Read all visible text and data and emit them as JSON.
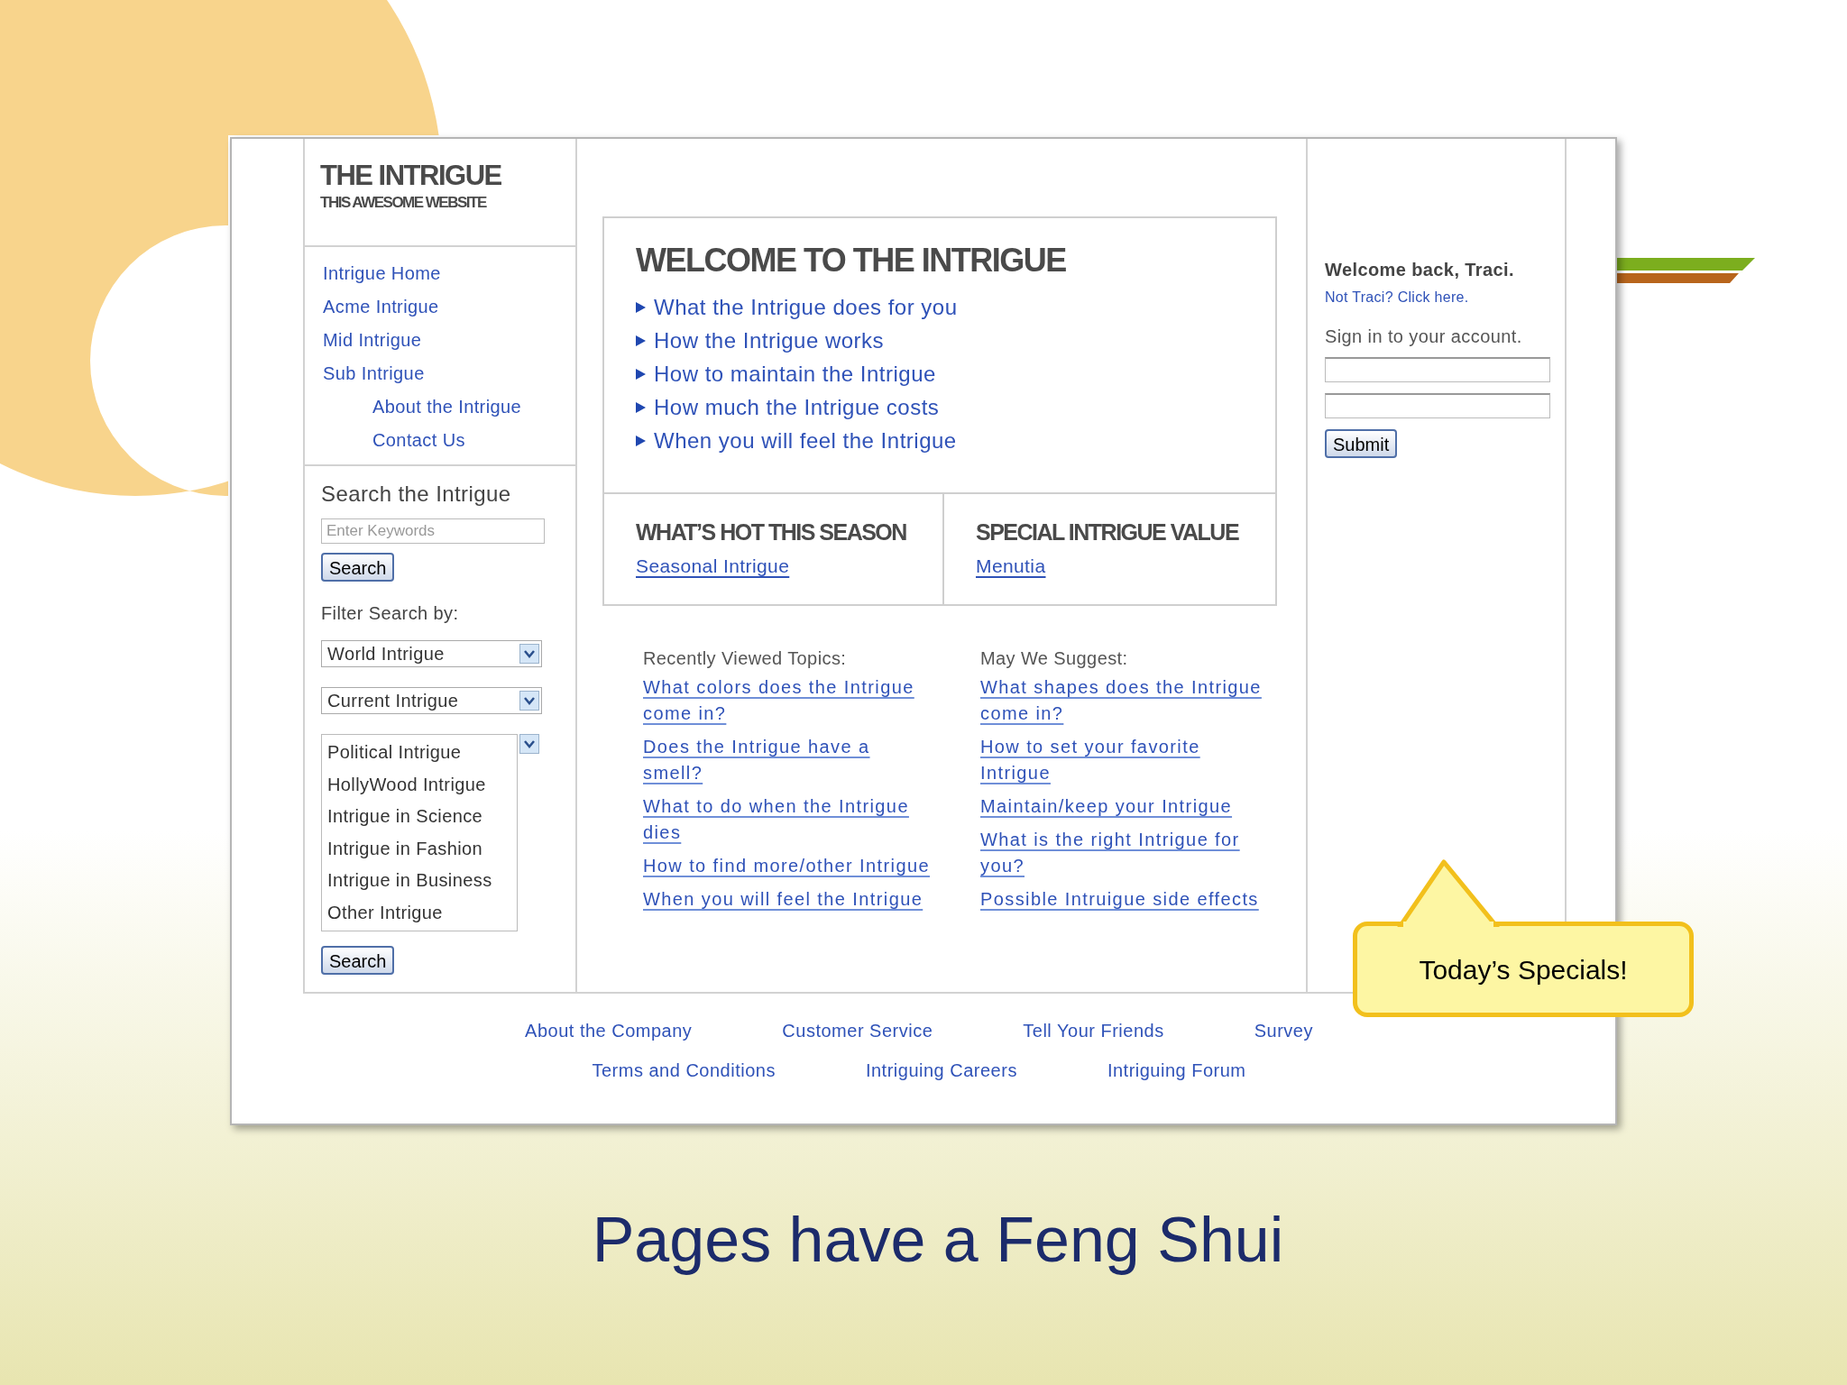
{
  "site": {
    "logo": {
      "title": "THE INTRIGUE",
      "subtitle": "THIS AWESOME WEBSITE"
    },
    "nav": [
      {
        "label": "Intrigue Home"
      },
      {
        "label": "Acme Intrigue"
      },
      {
        "label": "Mid Intrigue"
      },
      {
        "label": "Sub Intrigue",
        "children": [
          {
            "label": "About the Intrigue"
          },
          {
            "label": "Contact Us"
          }
        ]
      }
    ],
    "search": {
      "heading": "Search the Intrigue",
      "placeholder": "Enter Keywords",
      "button": "Search",
      "filter_label": "Filter Search by:",
      "dropdowns": [
        {
          "value": "World Intrigue"
        },
        {
          "value": "Current Intrigue"
        }
      ],
      "listbox": [
        "Political Intrigue",
        "HollyWood Intrigue",
        "Intrigue in Science",
        "Intrigue in Fashion",
        "Intrigue in Business",
        "Other Intrigue"
      ],
      "button_2": "Search"
    },
    "welcome": {
      "heading": "WELCOME TO THE INTRIGUE",
      "links": [
        "What the Intrigue does for you",
        "How the Intrigue works",
        "How to maintain the Intrigue",
        "How much the Intrigue costs",
        "When you will feel the Intrigue"
      ]
    },
    "promos": [
      {
        "heading": "WHAT’S HOT THIS SEASON",
        "link": "Seasonal Intrigue"
      },
      {
        "heading": "SPECIAL INTRIGUE VALUE",
        "link": "Menutia"
      }
    ],
    "topic_lists": [
      {
        "heading": "Recently Viewed Topics:",
        "links": [
          "What colors does the Intrigue come in?",
          "Does the Intrigue have a smell?",
          "What to do when the Intrigue dies",
          "How to find more/other Intrigue",
          "When you will feel the Intrigue"
        ]
      },
      {
        "heading": "May We Suggest:",
        "links": [
          "What shapes does the Intrigue come in?",
          "How to set your favorite Intrigue",
          "Maintain/keep your Intrigue",
          "What is the right Intrigue for you?",
          "Possible Intruigue side effects"
        ]
      }
    ],
    "account": {
      "greeting": "Welcome back, Traci.",
      "switch_link": "Not Traci? Click here.",
      "prompt": "Sign in to your account.",
      "button": "Submit"
    },
    "footer": [
      [
        "About the Company",
        "Customer Service",
        "Tell Your Friends",
        "Survey"
      ],
      [
        "Terms and Conditions",
        "Intriguing Careers",
        "Intriguing Forum"
      ]
    ]
  },
  "callout": {
    "text": "Today’s Specials!"
  },
  "slide": {
    "title": "Pages have a Feng Shui"
  }
}
